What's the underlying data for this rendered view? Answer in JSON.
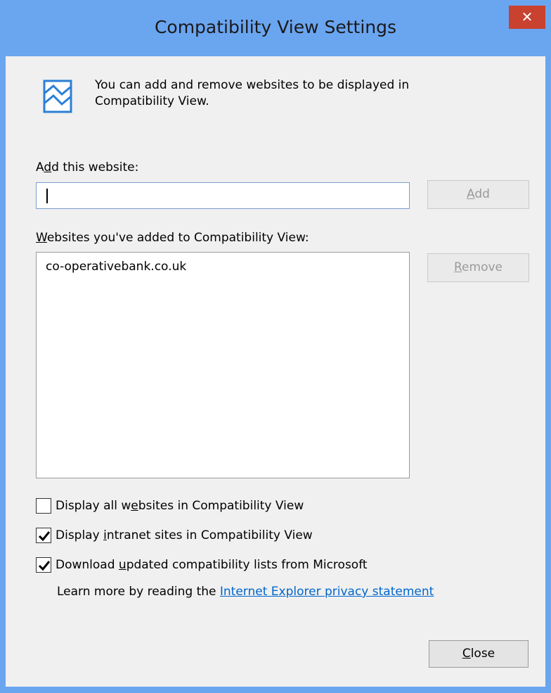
{
  "window": {
    "title": "Compatibility View Settings",
    "close_glyph": "✕"
  },
  "info": {
    "icon": "compatibility-view-icon",
    "text": "You can add and remove websites to be displayed in Compatibility View."
  },
  "add_section": {
    "label_pre": "A",
    "label_accel": "d",
    "label_post": "d this website:",
    "input_value": "",
    "add_button_accel": "A",
    "add_button_post": "dd"
  },
  "list_section": {
    "label_accel": "W",
    "label_post": "ebsites you've added to Compatibility View:",
    "items": [
      "co-operativebank.co.uk"
    ],
    "remove_button_accel": "R",
    "remove_button_post": "emove"
  },
  "options": [
    {
      "checked": false,
      "pre": "Display all w",
      "accel": "e",
      "post": "bsites in Compatibility View"
    },
    {
      "checked": true,
      "pre": "Display ",
      "accel": "i",
      "post": "ntranet sites in Compatibility View"
    },
    {
      "checked": true,
      "pre": "Download ",
      "accel": "u",
      "post": "pdated compatibility lists from Microsoft"
    }
  ],
  "learn_more": {
    "text": "Learn more by reading the ",
    "link": "Internet Explorer privacy statement"
  },
  "footer": {
    "close_accel": "C",
    "close_post": "lose"
  },
  "colors": {
    "titlebar": "#6aa5f0",
    "close_button": "#c9412f",
    "link": "#0066cc"
  }
}
